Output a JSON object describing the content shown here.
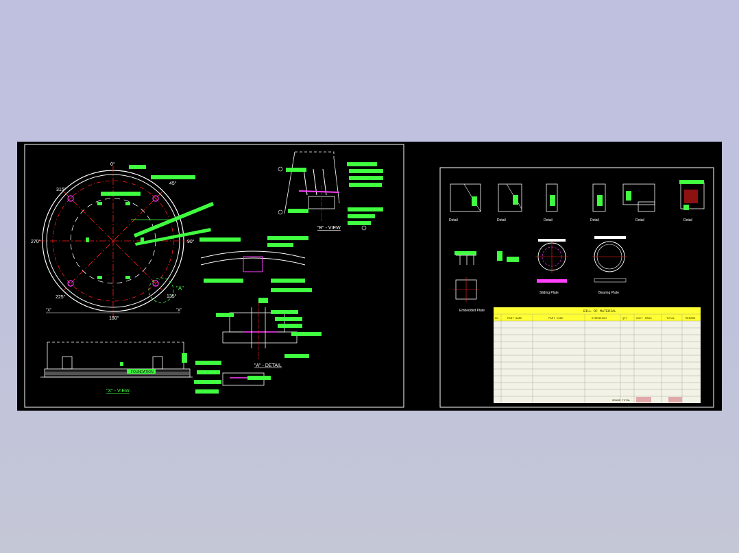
{
  "colors": {
    "background": "#bfc0df",
    "sheet": "#000000",
    "frame": "#ffffff",
    "centerline": "#ff2020",
    "tag": "#40ff40",
    "magenta": "#ff40ff",
    "dim": "#ffffff",
    "table_header": "#ffff33",
    "table_body": "#f2f2e6"
  },
  "sheet1": {
    "plan": {
      "angles": [
        "0°",
        "45°",
        "90°",
        "135°",
        "180°",
        "225°",
        "270°",
        "315°"
      ],
      "detail_callout": "\"A\"",
      "section_marks": [
        "\"X\"",
        "\"X\""
      ]
    },
    "x_view": {
      "title": "\"X\" - VIEW",
      "foundation": "FOUNDATION"
    },
    "a_detail": {
      "title": "\"A\" - DETAIL"
    },
    "b_view": {
      "title": "\"B\" - VIEW"
    }
  },
  "sheet2": {
    "details_row1": [
      "Detail",
      "Detail",
      "Detail",
      "Detail",
      "Detail",
      "Detail"
    ],
    "details_row2": [
      "Embedded Plate",
      "Sliding Plate",
      "Bearing Plate"
    ],
    "table": {
      "title": "BILL OF MATERIAL",
      "headers": [
        "NO",
        "PART NAME",
        "PART CODE",
        "DIMENSION",
        "QTY",
        "UNIT",
        "MASS",
        "TOTAL",
        "REMARK"
      ],
      "footer_label": "GRAND TOTAL"
    }
  }
}
